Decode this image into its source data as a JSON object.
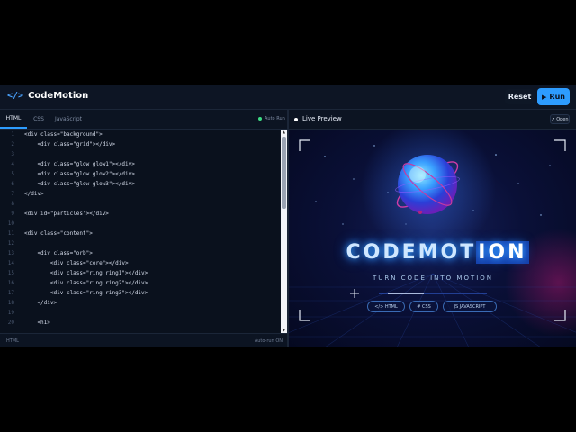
{
  "header": {
    "logo_icon": "</>",
    "brand": "CodeMotion",
    "reset_label": "Reset",
    "run_icon": "▶",
    "run_label": "Run"
  },
  "editor": {
    "tabs": [
      {
        "label": "HTML",
        "active": true
      },
      {
        "label": "CSS",
        "active": false
      },
      {
        "label": "JavaScript",
        "active": false
      }
    ],
    "autorun_label": "Auto Run",
    "lines": [
      {
        "n": "1",
        "code": "<div class=\"background\">"
      },
      {
        "n": "2",
        "code": "    <div class=\"grid\"></div>"
      },
      {
        "n": "3",
        "code": ""
      },
      {
        "n": "4",
        "code": "    <div class=\"glow glow1\"></div>"
      },
      {
        "n": "5",
        "code": "    <div class=\"glow glow2\"></div>"
      },
      {
        "n": "6",
        "code": "    <div class=\"glow glow3\"></div>"
      },
      {
        "n": "7",
        "code": "</div>"
      },
      {
        "n": "8",
        "code": ""
      },
      {
        "n": "9",
        "code": "<div id=\"particles\"></div>"
      },
      {
        "n": "10",
        "code": ""
      },
      {
        "n": "11",
        "code": "<div class=\"content\">"
      },
      {
        "n": "12",
        "code": ""
      },
      {
        "n": "13",
        "code": "    <div class=\"orb\">"
      },
      {
        "n": "14",
        "code": "        <div class=\"core\"></div>"
      },
      {
        "n": "15",
        "code": "        <div class=\"ring ring1\"></div>"
      },
      {
        "n": "16",
        "code": "        <div class=\"ring ring2\"></div>"
      },
      {
        "n": "17",
        "code": "        <div class=\"ring ring3\"></div>"
      },
      {
        "n": "18",
        "code": "    </div>"
      },
      {
        "n": "19",
        "code": ""
      },
      {
        "n": "20",
        "code": "    <h1>"
      }
    ],
    "status_left": "HTML",
    "status_right": "Auto-run ON"
  },
  "preview": {
    "live_label": "Live Preview",
    "open_label": "↗ Open",
    "title_main": "CODEMOT",
    "title_highlight": "ION",
    "subtitle": "TURN CODE INTO MOTION",
    "pills": [
      {
        "label": "</> HTML"
      },
      {
        "label": "# CSS"
      },
      {
        "label": "JS JAVASCRIPT"
      }
    ]
  },
  "colors": {
    "accent": "#2d9cff",
    "background": "#0b1220",
    "live_dot": "#3ddc84"
  }
}
